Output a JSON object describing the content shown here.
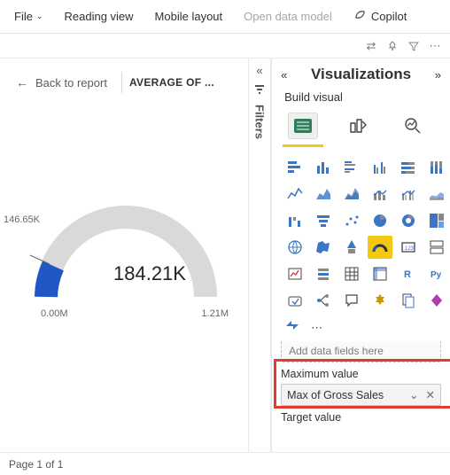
{
  "menu": {
    "file": "File",
    "reading_view": "Reading view",
    "mobile_layout": "Mobile layout",
    "open_data_model": "Open data model",
    "copilot": "Copilot"
  },
  "canvas": {
    "back": "Back to report",
    "viz_title": "AVERAGE OF ...",
    "gauge": {
      "left_label": "146.65K",
      "value": "184.21K",
      "min": "0.00M",
      "max": "1.21M"
    }
  },
  "filters_label": "Filters",
  "pane": {
    "title": "Visualizations",
    "subtitle": "Build visual",
    "add_fields_placeholder": "Add data fields here",
    "max_label": "Maximum value",
    "max_field": "Max of Gross Sales",
    "target_label": "Target value"
  },
  "footer": {
    "page": "Page 1 of 1"
  },
  "chart_data": {
    "type": "gauge",
    "value": 184210,
    "min": 0,
    "max": 1210000,
    "marker": 146650,
    "value_label": "184.21K",
    "min_label": "0.00M",
    "max_label": "1.21M",
    "marker_label": "146.65K"
  }
}
